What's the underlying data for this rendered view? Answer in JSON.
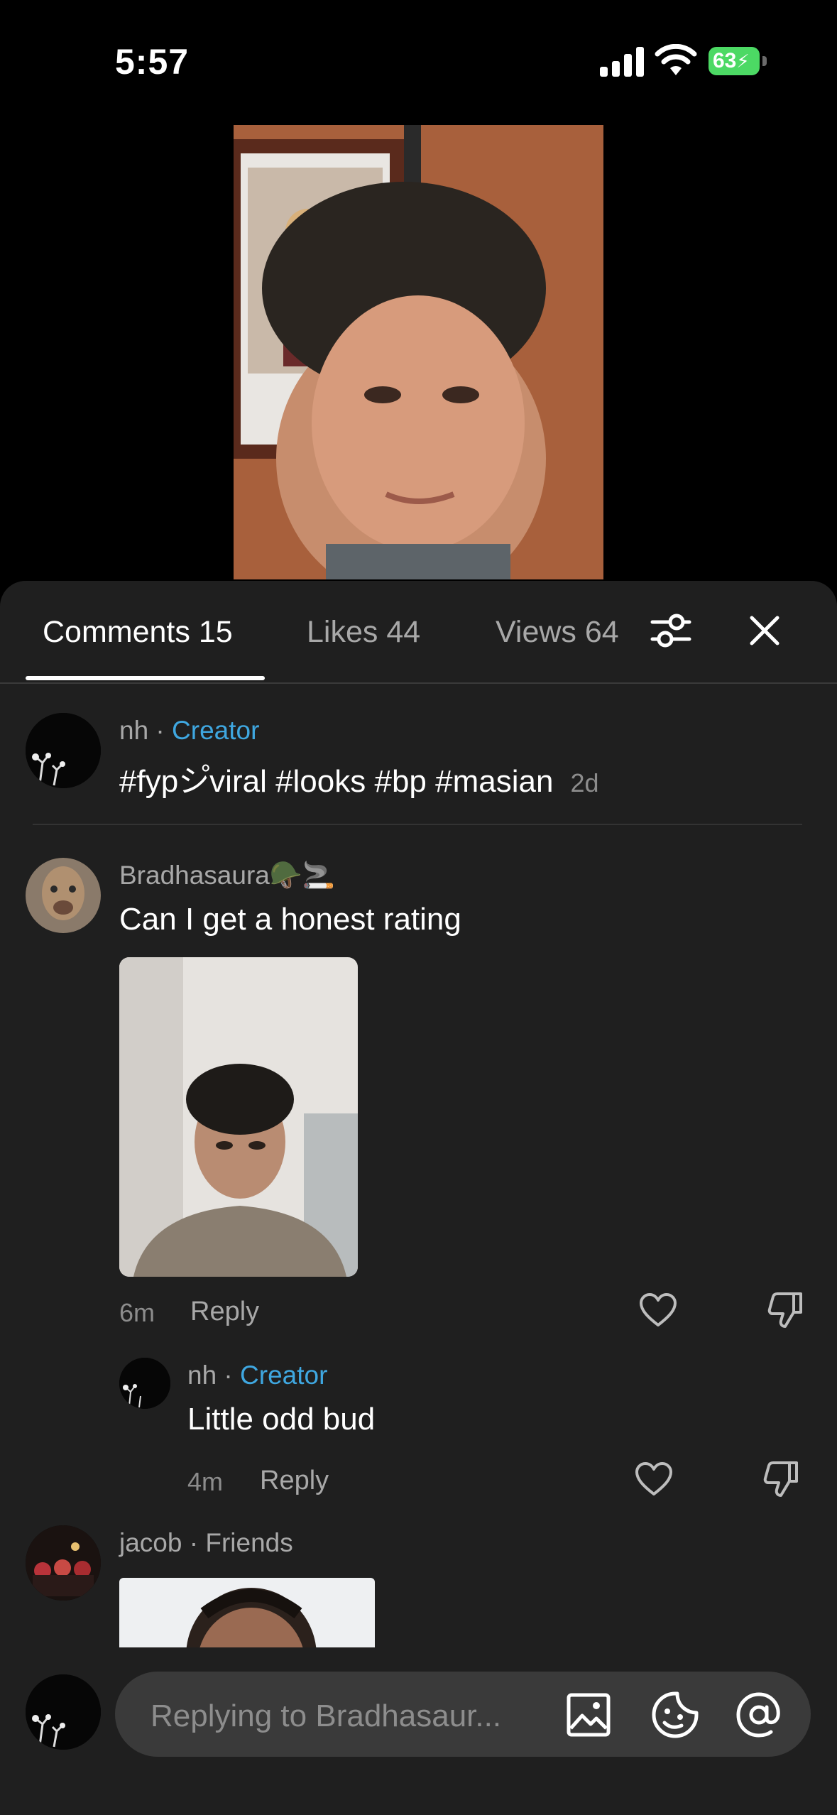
{
  "status_bar": {
    "time": "5:57",
    "battery": "63"
  },
  "tabs": [
    {
      "label": "Comments 15",
      "active": true
    },
    {
      "label": "Likes 44",
      "active": false
    },
    {
      "label": "Views 64",
      "active": false
    }
  ],
  "icons": {
    "filter": "sliders-icon",
    "close": "close-icon",
    "like": "heart-icon",
    "dislike": "thumbs-down-icon",
    "image": "image-icon",
    "sticker": "sticker-icon",
    "mention": "at-icon"
  },
  "caption": {
    "author": "nh",
    "separator": " · ",
    "badge": "Creator",
    "text": "#fypシ゚viral #looks #bp #masian",
    "time": "2d"
  },
  "comments": [
    {
      "author": "Bradhasaura🪖🚬",
      "text": "Can I get a honest rating",
      "time": "6m",
      "reply_label": "Reply",
      "replies": [
        {
          "author": "nh",
          "separator": " · ",
          "badge": "Creator",
          "text": "Little odd bud",
          "time": "4m",
          "reply_label": "Reply"
        }
      ]
    },
    {
      "author": "jacob",
      "separator": " · ",
      "badge": "Friends"
    }
  ],
  "composer": {
    "placeholder": "Replying to Bradhasaur..."
  },
  "colors": {
    "accent_creator": "#3fa7e0",
    "sheet_bg": "#1f1f1f",
    "battery": "#4cd964"
  }
}
